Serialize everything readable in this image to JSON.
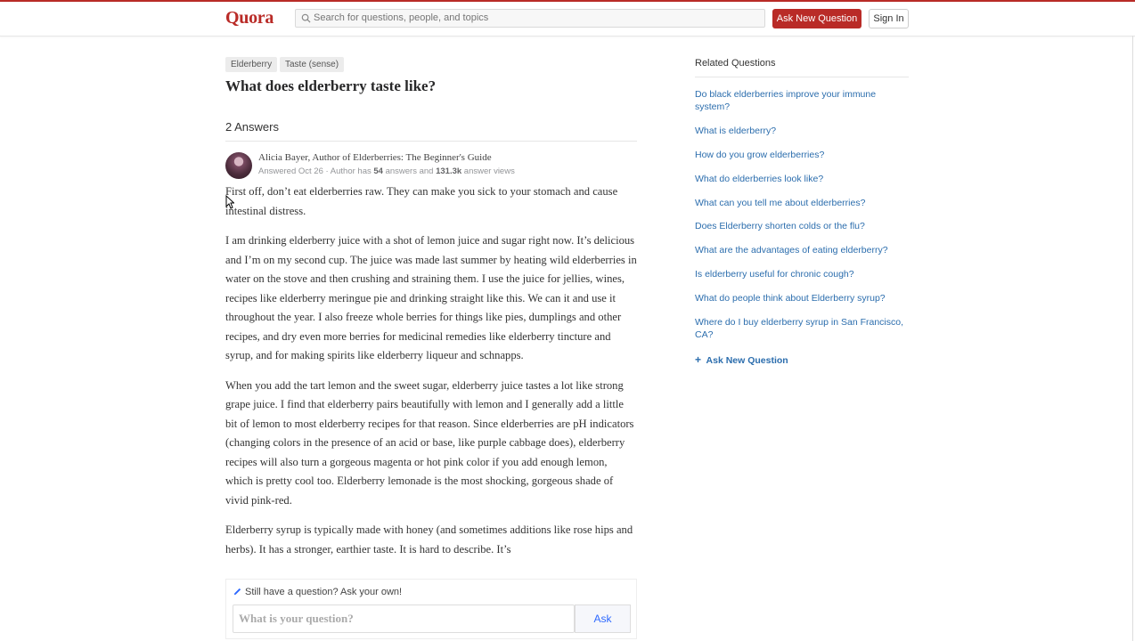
{
  "header": {
    "logo": "Quora",
    "search_placeholder": "Search for questions, people, and topics",
    "ask_button": "Ask New Question",
    "signin_button": "Sign In",
    "accent_color": "#b92b27"
  },
  "question": {
    "topics": [
      "Elderberry",
      "Taste (sense)"
    ],
    "title": "What does elderberry taste like?",
    "answers_count": "2 Answers"
  },
  "answer": {
    "author": "Alicia Bayer, Author of Elderberries: The Beginner's Guide",
    "meta_prefix": "Answered Oct 26 · Author has ",
    "meta_answers": "54",
    "meta_mid": " answers and ",
    "meta_views": "131.3k",
    "meta_suffix": " answer views",
    "paragraphs": [
      "First off, don’t eat elderberries raw. They can make you sick to your stomach and cause intestinal distress.",
      "I am drinking elderberry juice with a shot of lemon juice and sugar right now. It’s delicious and I’m on my second cup. The juice was made last summer by heating wild elderberries in water on the stove and then crushing and straining them. I use the juice for jellies, wines, recipes like elderberry meringue pie and drinking straight like this. We can it and use it throughout the year. I also freeze whole berries for things like pies, dumplings and other recipes, and dry even more berries for medicinal remedies like elderberry tincture and syrup, and for making spirits like elderberry liqueur and schnapps.",
      "When you add the tart lemon and the sweet sugar, elderberry juice tastes a lot like strong grape juice. I find that elderberry pairs beautifully with lemon and I generally add a little bit of lemon to most elderberry recipes for that reason. Since elderberries are pH indicators (changing colors in the presence of an acid or base, like purple cabbage does), elderberry recipes will also turn a gorgeous magenta or hot pink color if you add enough lemon, which is pretty cool too. Elderberry lemonade is the most shocking, gorgeous shade of vivid pink-red.",
      "Elderberry syrup is typically made with honey (and sometimes additions like rose hips and herbs). It has a stronger, earthier taste. It is hard to describe. It’s"
    ]
  },
  "ask_box": {
    "prompt": "Still have a question? Ask your own!",
    "placeholder": "What is your question?",
    "submit": "Ask"
  },
  "related": {
    "heading": "Related Questions",
    "items": [
      "Do black elderberries improve your immune system?",
      "What is elderberry?",
      "How do you grow elderberries?",
      "What do elderberries look like?",
      "What can you tell me about elderberries?",
      "Does Elderberry shorten colds or the flu?",
      "What are the advantages of eating elderberry?",
      "Is elderberry useful for chronic cough?",
      "What do people think about Elderberry syrup?",
      "Where do I buy elderberry syrup in San Francisco, CA?"
    ],
    "ask_link": "Ask New Question"
  }
}
